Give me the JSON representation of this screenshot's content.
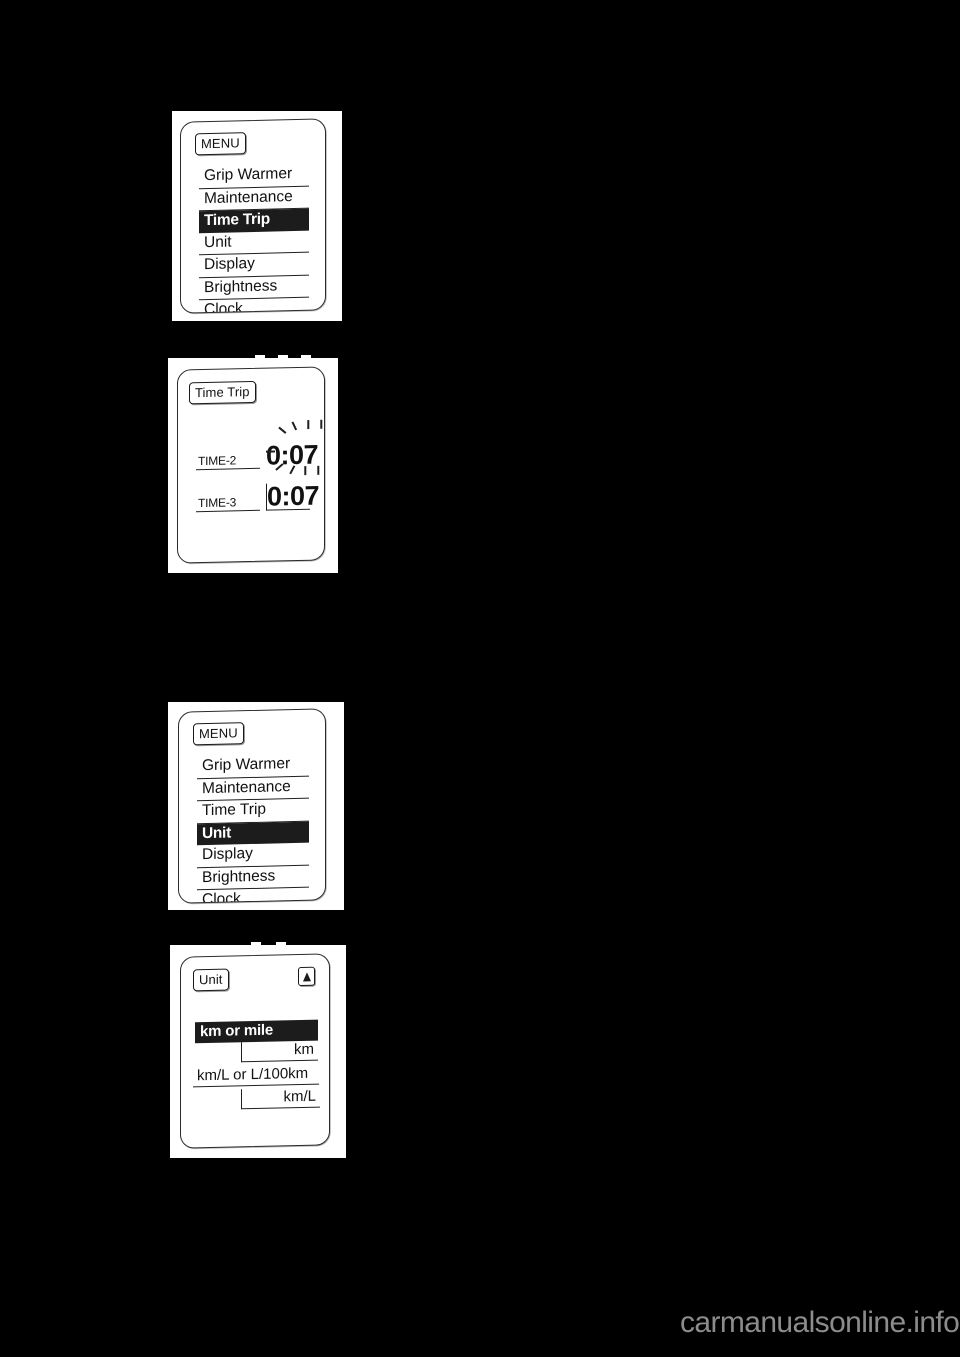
{
  "page": {
    "background_color": "#000000",
    "plate_color": "#ffffff",
    "highlight_color": "#1c1c1c",
    "line_color": "#1f1f1f",
    "watermark": "carmanualsonline.info",
    "watermark_color": "#8c8c8c"
  },
  "panels": [
    {
      "id": "menu-time-trip",
      "type": "menu-screen",
      "tag": "MENU",
      "items": [
        {
          "label": "Grip Warmer",
          "selected": false
        },
        {
          "label": "Maintenance",
          "selected": false
        },
        {
          "label": "Time Trip",
          "selected": true
        },
        {
          "label": "Unit",
          "selected": false
        },
        {
          "label": "Display",
          "selected": false
        },
        {
          "label": "Brightness",
          "selected": false
        },
        {
          "label": "Clock",
          "selected": false
        }
      ]
    },
    {
      "id": "time-trip-screen",
      "type": "value-screen",
      "tag": "Time Trip",
      "rows": [
        {
          "label": "TIME-2",
          "value": "0:07",
          "flashing": true
        },
        {
          "label": "TIME-3",
          "value": "0:07",
          "flashing": false
        }
      ]
    },
    {
      "id": "menu-unit",
      "type": "menu-screen",
      "tag": "MENU",
      "items": [
        {
          "label": "Grip Warmer",
          "selected": false
        },
        {
          "label": "Maintenance",
          "selected": false
        },
        {
          "label": "Time Trip",
          "selected": false
        },
        {
          "label": "Unit",
          "selected": true
        },
        {
          "label": "Display",
          "selected": false
        },
        {
          "label": "Brightness",
          "selected": false
        },
        {
          "label": "Clock",
          "selected": false
        }
      ]
    },
    {
      "id": "unit-screen",
      "type": "unit-screen",
      "tag": "Unit",
      "scroll_icon": "up-arrow-icon",
      "rows": [
        {
          "heading": "km or mile",
          "selected": true,
          "value": "km"
        },
        {
          "heading": "km/L or L/100km",
          "selected": false,
          "value": "km/L"
        }
      ]
    }
  ]
}
